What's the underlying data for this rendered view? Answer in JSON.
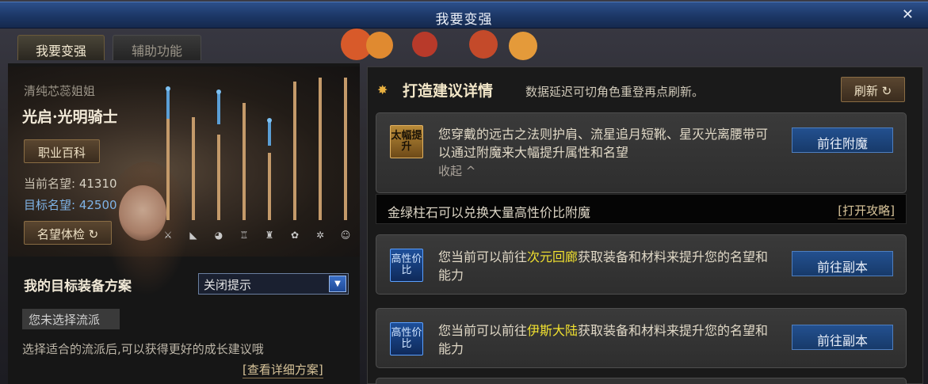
{
  "window": {
    "title": "我要变强",
    "close_glyph": "✕"
  },
  "tabs": [
    {
      "label": "我要变强",
      "active": true
    },
    {
      "label": "辅助功能",
      "active": false
    }
  ],
  "character": {
    "name": "清纯芯蕊姐姐",
    "class": "光启·光明骑士",
    "wiki_button": "职业百科",
    "current_fame_label": "当前名望:",
    "current_fame": "41310",
    "target_fame_label": "目标名望:",
    "target_fame": "42500",
    "fame_check_button": "名望体检",
    "refresh_glyph": "↻"
  },
  "slot_bars": [
    {
      "slot": "weapon-icon",
      "fame_level": 0.92,
      "target_level": 0.85
    },
    {
      "slot": "shoulder-icon",
      "fame_level": 0.72,
      "target_level": null
    },
    {
      "slot": "top-icon",
      "fame_level": 0.6,
      "target_level": 0.9
    },
    {
      "slot": "belt-icon",
      "fame_level": 0.82,
      "target_level": null
    },
    {
      "slot": "bottom-icon",
      "fame_level": 0.47,
      "target_level": 0.7
    },
    {
      "slot": "shoes-icon",
      "fame_level": 0.97,
      "target_level": null
    },
    {
      "slot": "bracelet-icon",
      "fame_level": 1.0,
      "target_level": null
    },
    {
      "slot": "necklace-icon",
      "fame_level": 1.0,
      "target_level": null
    }
  ],
  "plan": {
    "title": "我的目标装备方案",
    "select_value": "关闭提示",
    "no_faction": "您未选择流派",
    "hint": "选择适合的流派后,可以获得更好的成长建议哦",
    "detail_link": "[查看详细方案]"
  },
  "suggestions": {
    "title": "打造建议详情",
    "subtitle": "数据延迟可切角色重登再点刷新。",
    "refresh_button": "刷新",
    "cards": [
      {
        "badge": "太幅提升",
        "badge_style": "gold",
        "text_before": "您穿戴的远古之法则护肩、流星追月短靴、星灭光离腰带可以通过附魔来大幅提升属性和名望",
        "highlight": "",
        "text_after": "",
        "collapse": "收起 ^",
        "button": "前往附魔"
      },
      {
        "badge": "高性价比",
        "badge_style": "blue",
        "text_before": "您当前可以前往",
        "highlight": "次元回廊",
        "text_after": "获取装备和材料来提升您的名望和能力",
        "button": "前往副本"
      },
      {
        "badge": "高性价比",
        "badge_style": "blue",
        "text_before": "您当前可以前往",
        "highlight": "伊斯大陆",
        "text_after": "获取装备和材料来提升您的名望和能力",
        "button": "前往副本"
      }
    ],
    "strip": {
      "text": "金绿柱石可以兑换大量高性价比附魔",
      "link": "[打开攻略]"
    }
  },
  "colors": {
    "bar": "#c49a6a",
    "bar_target": "#5b9fd6",
    "highlight": "#f0e030",
    "go_button": "#23508f"
  }
}
